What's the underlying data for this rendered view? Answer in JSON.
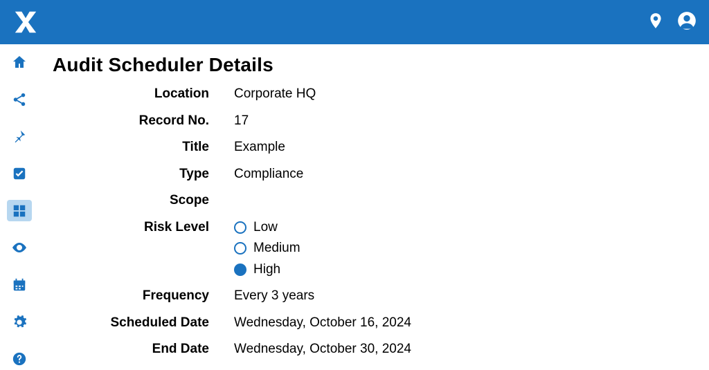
{
  "page": {
    "title": "Audit Scheduler Details"
  },
  "labels": {
    "location": "Location",
    "record_no": "Record No.",
    "title": "Title",
    "type": "Type",
    "scope": "Scope",
    "risk_level": "Risk Level",
    "frequency": "Frequency",
    "scheduled_date": "Scheduled Date",
    "end_date": "End Date"
  },
  "values": {
    "location": "Corporate HQ",
    "record_no": "17",
    "title": "Example",
    "type": "Compliance",
    "scope": "",
    "frequency": "Every 3 years",
    "scheduled_date": "Wednesday, October 16, 2024",
    "end_date": "Wednesday, October 30, 2024"
  },
  "risk_level": {
    "options": [
      {
        "label": "Low",
        "selected": false
      },
      {
        "label": "Medium",
        "selected": false
      },
      {
        "label": "High",
        "selected": true
      }
    ]
  },
  "sidebar": {
    "items": [
      {
        "name": "home"
      },
      {
        "name": "share"
      },
      {
        "name": "pin"
      },
      {
        "name": "checkbox"
      },
      {
        "name": "grid"
      },
      {
        "name": "eye"
      },
      {
        "name": "calendar"
      },
      {
        "name": "settings"
      },
      {
        "name": "help"
      }
    ],
    "active": "grid"
  }
}
